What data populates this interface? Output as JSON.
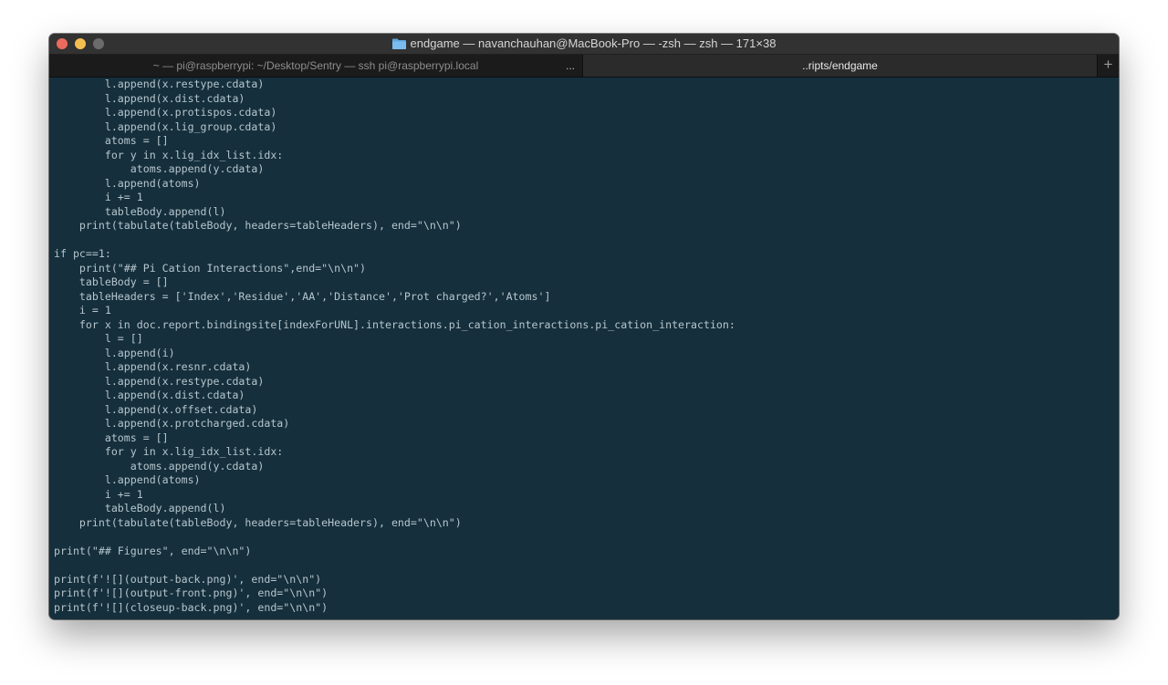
{
  "window": {
    "title": "endgame — navanchauhan@MacBook-Pro — -zsh — zsh — 171×38"
  },
  "tabs": [
    {
      "label": "~ — pi@raspberrypi: ~/Desktop/Sentry — ssh pi@raspberrypi.local",
      "ellipsis": "..."
    },
    {
      "label": "..ripts/endgame"
    }
  ],
  "new_tab_symbol": "+",
  "colors": {
    "terminal_bg": "#152f3c",
    "terminal_fg": "#b7c6cd",
    "close": "#ed6a5e",
    "minimize": "#f5bf4f"
  },
  "terminal": {
    "lines": [
      "        l.append(x.restype.cdata)",
      "        l.append(x.dist.cdata)",
      "        l.append(x.protispos.cdata)",
      "        l.append(x.lig_group.cdata)",
      "        atoms = []",
      "        for y in x.lig_idx_list.idx:",
      "            atoms.append(y.cdata)",
      "        l.append(atoms)",
      "        i += 1",
      "        tableBody.append(l)",
      "    print(tabulate(tableBody, headers=tableHeaders), end=\"\\n\\n\")",
      "",
      "if pc==1:",
      "    print(\"## Pi Cation Interactions\",end=\"\\n\\n\")",
      "    tableBody = []",
      "    tableHeaders = ['Index','Residue','AA','Distance','Prot charged?','Atoms']",
      "    i = 1",
      "    for x in doc.report.bindingsite[indexForUNL].interactions.pi_cation_interactions.pi_cation_interaction:",
      "        l = []",
      "        l.append(i)",
      "        l.append(x.resnr.cdata)",
      "        l.append(x.restype.cdata)",
      "        l.append(x.dist.cdata)",
      "        l.append(x.offset.cdata)",
      "        l.append(x.protcharged.cdata)",
      "        atoms = []",
      "        for y in x.lig_idx_list.idx:",
      "            atoms.append(y.cdata)",
      "        l.append(atoms)",
      "        i += 1",
      "        tableBody.append(l)",
      "    print(tabulate(tableBody, headers=tableHeaders), end=\"\\n\\n\")",
      "",
      "print(\"## Figures\", end=\"\\n\\n\")",
      "",
      "print(f'![](output-back.png)', end=\"\\n\\n\")",
      "print(f'![](output-front.png)', end=\"\\n\\n\")",
      "print(f'![](closeup-back.png)', end=\"\\n\\n\")"
    ]
  }
}
